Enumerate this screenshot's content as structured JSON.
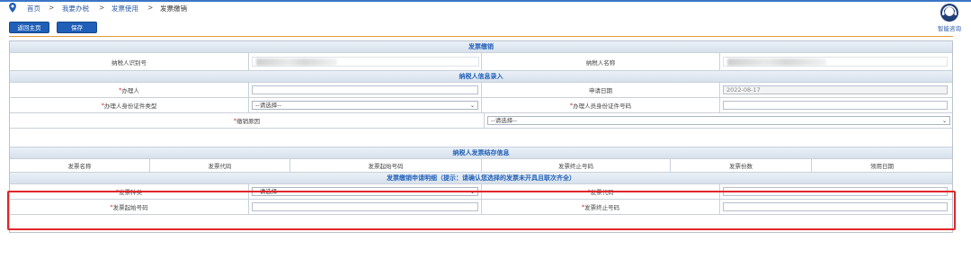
{
  "breadcrumb": [
    "首页",
    ">",
    "我要办税",
    ">",
    "发票使用",
    ">",
    "发票缴销"
  ],
  "toolbar": {
    "back_label": "返回主页",
    "save_label": "保存"
  },
  "assistant": {
    "label": "智能咨询"
  },
  "sections": {
    "cancel_title": "发票缴销",
    "taxpayer_entry": "纳税人信息录入",
    "stock_info": "纳税人发票结存信息",
    "detail_title": "发票缴销申请明细（提示：请确认您选择的发票未开具且联次齐全）"
  },
  "taxpayer": {
    "id_label": "纳税人识别号",
    "name_label": "纳税人名称"
  },
  "form": {
    "handler_label": "办理人",
    "apply_date_label": "申请日期",
    "apply_date_value": "2022-08-17",
    "id_type_label": "办理人身份证件类型",
    "id_type_value": "--请选择--",
    "id_no_label": "办理人员身份证件号码",
    "reason_label": "缴销原因",
    "reason_value": "--请选择--"
  },
  "stock_columns": [
    "发票名称",
    "发票代码",
    "发票起始号码",
    "发票终止号码",
    "发票份数",
    "领用日期"
  ],
  "detail": {
    "kind_label": "发票种类",
    "kind_value": "--请选择--",
    "code_label": "发票代码",
    "start_label": "发票起始号码",
    "end_label": "发票终止号码"
  },
  "required_mark": "*",
  "colors": {
    "accent": "#1f5fb8",
    "highlight": "#e0262a",
    "rule": "#e39a3b"
  }
}
